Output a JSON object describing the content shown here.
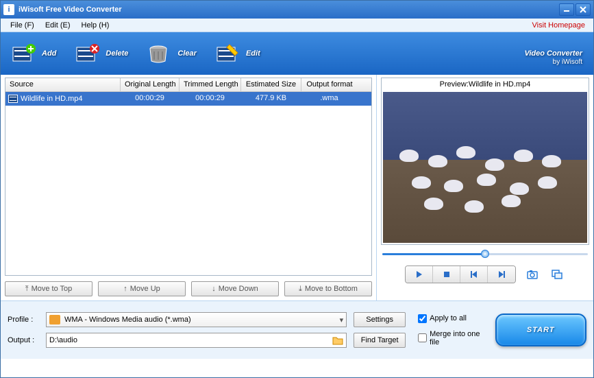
{
  "window": {
    "title": "iWisoft Free Video Converter"
  },
  "menu": {
    "file": "File (F)",
    "edit": "Edit (E)",
    "help": "Help (H)",
    "homepage": "Visit Homepage"
  },
  "toolbar": {
    "add": "Add",
    "delete": "Delete",
    "clear": "Clear",
    "edit": "Edit",
    "brand": "Video Converter",
    "brand_sub": "by iWisoft"
  },
  "grid": {
    "headers": {
      "source": "Source",
      "orig": "Original Length",
      "trim": "Trimmed Length",
      "size": "Estimated Size",
      "fmt": "Output format"
    },
    "row": {
      "source": "Wildlife in HD.mp4",
      "orig": "00:00:29",
      "trim": "00:00:29",
      "size": "477.9 KB",
      "fmt": ".wma"
    }
  },
  "move": {
    "top": "Move to Top",
    "up": "Move Up",
    "down": "Move Down",
    "bottom": "Move to Bottom"
  },
  "preview": {
    "label": "Preview:Wildlife in HD.mp4"
  },
  "bottom": {
    "profile_label": "Profile :",
    "profile_value": "WMA - Windows Media audio (*.wma)",
    "output_label": "Output :",
    "output_value": "D:\\audio",
    "settings": "Settings",
    "find_target": "Find Target",
    "apply_all": "Apply to all",
    "merge": "Merge into one file",
    "start": "START"
  }
}
